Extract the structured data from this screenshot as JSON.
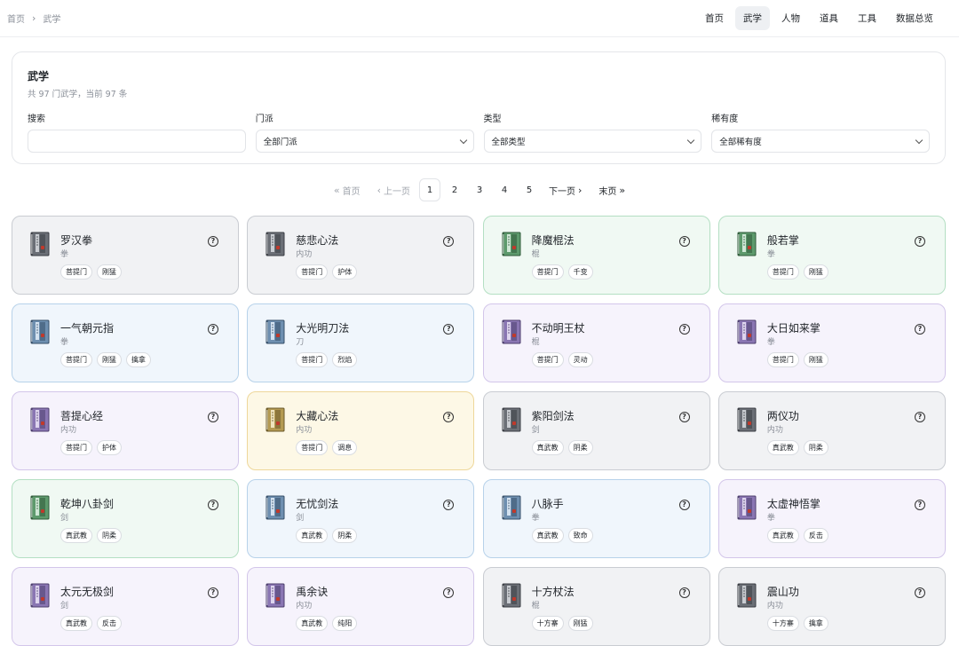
{
  "breadcrumb": {
    "home": "首页",
    "separator": "›",
    "current": "武学"
  },
  "nav": [
    "首页",
    "武学",
    "人物",
    "道具",
    "工具",
    "数据总览"
  ],
  "nav_active": 1,
  "panel": {
    "title": "武学",
    "subtitle": "共 97 门武学，当前 97 条",
    "filters": [
      {
        "label": "搜索",
        "value": "",
        "type": "input"
      },
      {
        "label": "门派",
        "value": "全部门派",
        "type": "select"
      },
      {
        "label": "类型",
        "value": "全部类型",
        "type": "select"
      },
      {
        "label": "稀有度",
        "value": "全部稀有度",
        "type": "select"
      }
    ]
  },
  "pager": {
    "first": "首页",
    "first_glyph": "«",
    "prev": "上一页",
    "prev_glyph": "‹",
    "pages": [
      "1",
      "2",
      "3",
      "4",
      "5"
    ],
    "current": "1",
    "next": "下一页",
    "next_glyph": "›",
    "last": "末页",
    "last_glyph": "»"
  },
  "colors": {
    "gray": "#f1f2f4",
    "green": "#f0f9f3",
    "blue": "#f0f6fc",
    "purple": "#f6f3fc",
    "yellow": "#fdf8e6"
  },
  "cards": [
    {
      "name": "罗汉拳",
      "type": "拳",
      "tags": [
        "菩提门",
        "刚猛"
      ],
      "rarity": "gray"
    },
    {
      "name": "慈悲心法",
      "type": "内功",
      "tags": [
        "菩提门",
        "护体"
      ],
      "rarity": "gray"
    },
    {
      "name": "降魔棍法",
      "type": "棍",
      "tags": [
        "菩提门",
        "千变"
      ],
      "rarity": "green"
    },
    {
      "name": "般若掌",
      "type": "拳",
      "tags": [
        "菩提门",
        "刚猛"
      ],
      "rarity": "green"
    },
    {
      "name": "一气朝元指",
      "type": "拳",
      "tags": [
        "菩提门",
        "刚猛",
        "擒拿"
      ],
      "rarity": "blue"
    },
    {
      "name": "大光明刀法",
      "type": "刀",
      "tags": [
        "菩提门",
        "烈焰"
      ],
      "rarity": "blue"
    },
    {
      "name": "不动明王杖",
      "type": "棍",
      "tags": [
        "菩提门",
        "灵动"
      ],
      "rarity": "purple"
    },
    {
      "name": "大日如来掌",
      "type": "拳",
      "tags": [
        "菩提门",
        "刚猛"
      ],
      "rarity": "purple"
    },
    {
      "name": "菩提心经",
      "type": "内功",
      "tags": [
        "菩提门",
        "护体"
      ],
      "rarity": "purple"
    },
    {
      "name": "大藏心法",
      "type": "内功",
      "tags": [
        "菩提门",
        "调息"
      ],
      "rarity": "yellow"
    },
    {
      "name": "紫阳剑法",
      "type": "剑",
      "tags": [
        "真武教",
        "阴柔"
      ],
      "rarity": "gray"
    },
    {
      "name": "两仪功",
      "type": "内功",
      "tags": [
        "真武教",
        "阴柔"
      ],
      "rarity": "gray"
    },
    {
      "name": "乾坤八卦剑",
      "type": "剑",
      "tags": [
        "真武教",
        "阴柔"
      ],
      "rarity": "green"
    },
    {
      "name": "无忧剑法",
      "type": "剑",
      "tags": [
        "真武教",
        "阴柔"
      ],
      "rarity": "blue"
    },
    {
      "name": "八脉手",
      "type": "拳",
      "tags": [
        "真武教",
        "致命"
      ],
      "rarity": "blue"
    },
    {
      "name": "太虚神悟掌",
      "type": "拳",
      "tags": [
        "真武教",
        "反击"
      ],
      "rarity": "purple"
    },
    {
      "name": "太元无极剑",
      "type": "剑",
      "tags": [
        "真武教",
        "反击"
      ],
      "rarity": "purple"
    },
    {
      "name": "禹余诀",
      "type": "内功",
      "tags": [
        "真武教",
        "纯阳"
      ],
      "rarity": "purple"
    },
    {
      "name": "十方杖法",
      "type": "棍",
      "tags": [
        "十方寨",
        "刚猛"
      ],
      "rarity": "gray"
    },
    {
      "name": "震山功",
      "type": "内功",
      "tags": [
        "十方寨",
        "擒拿"
      ],
      "rarity": "gray"
    }
  ]
}
